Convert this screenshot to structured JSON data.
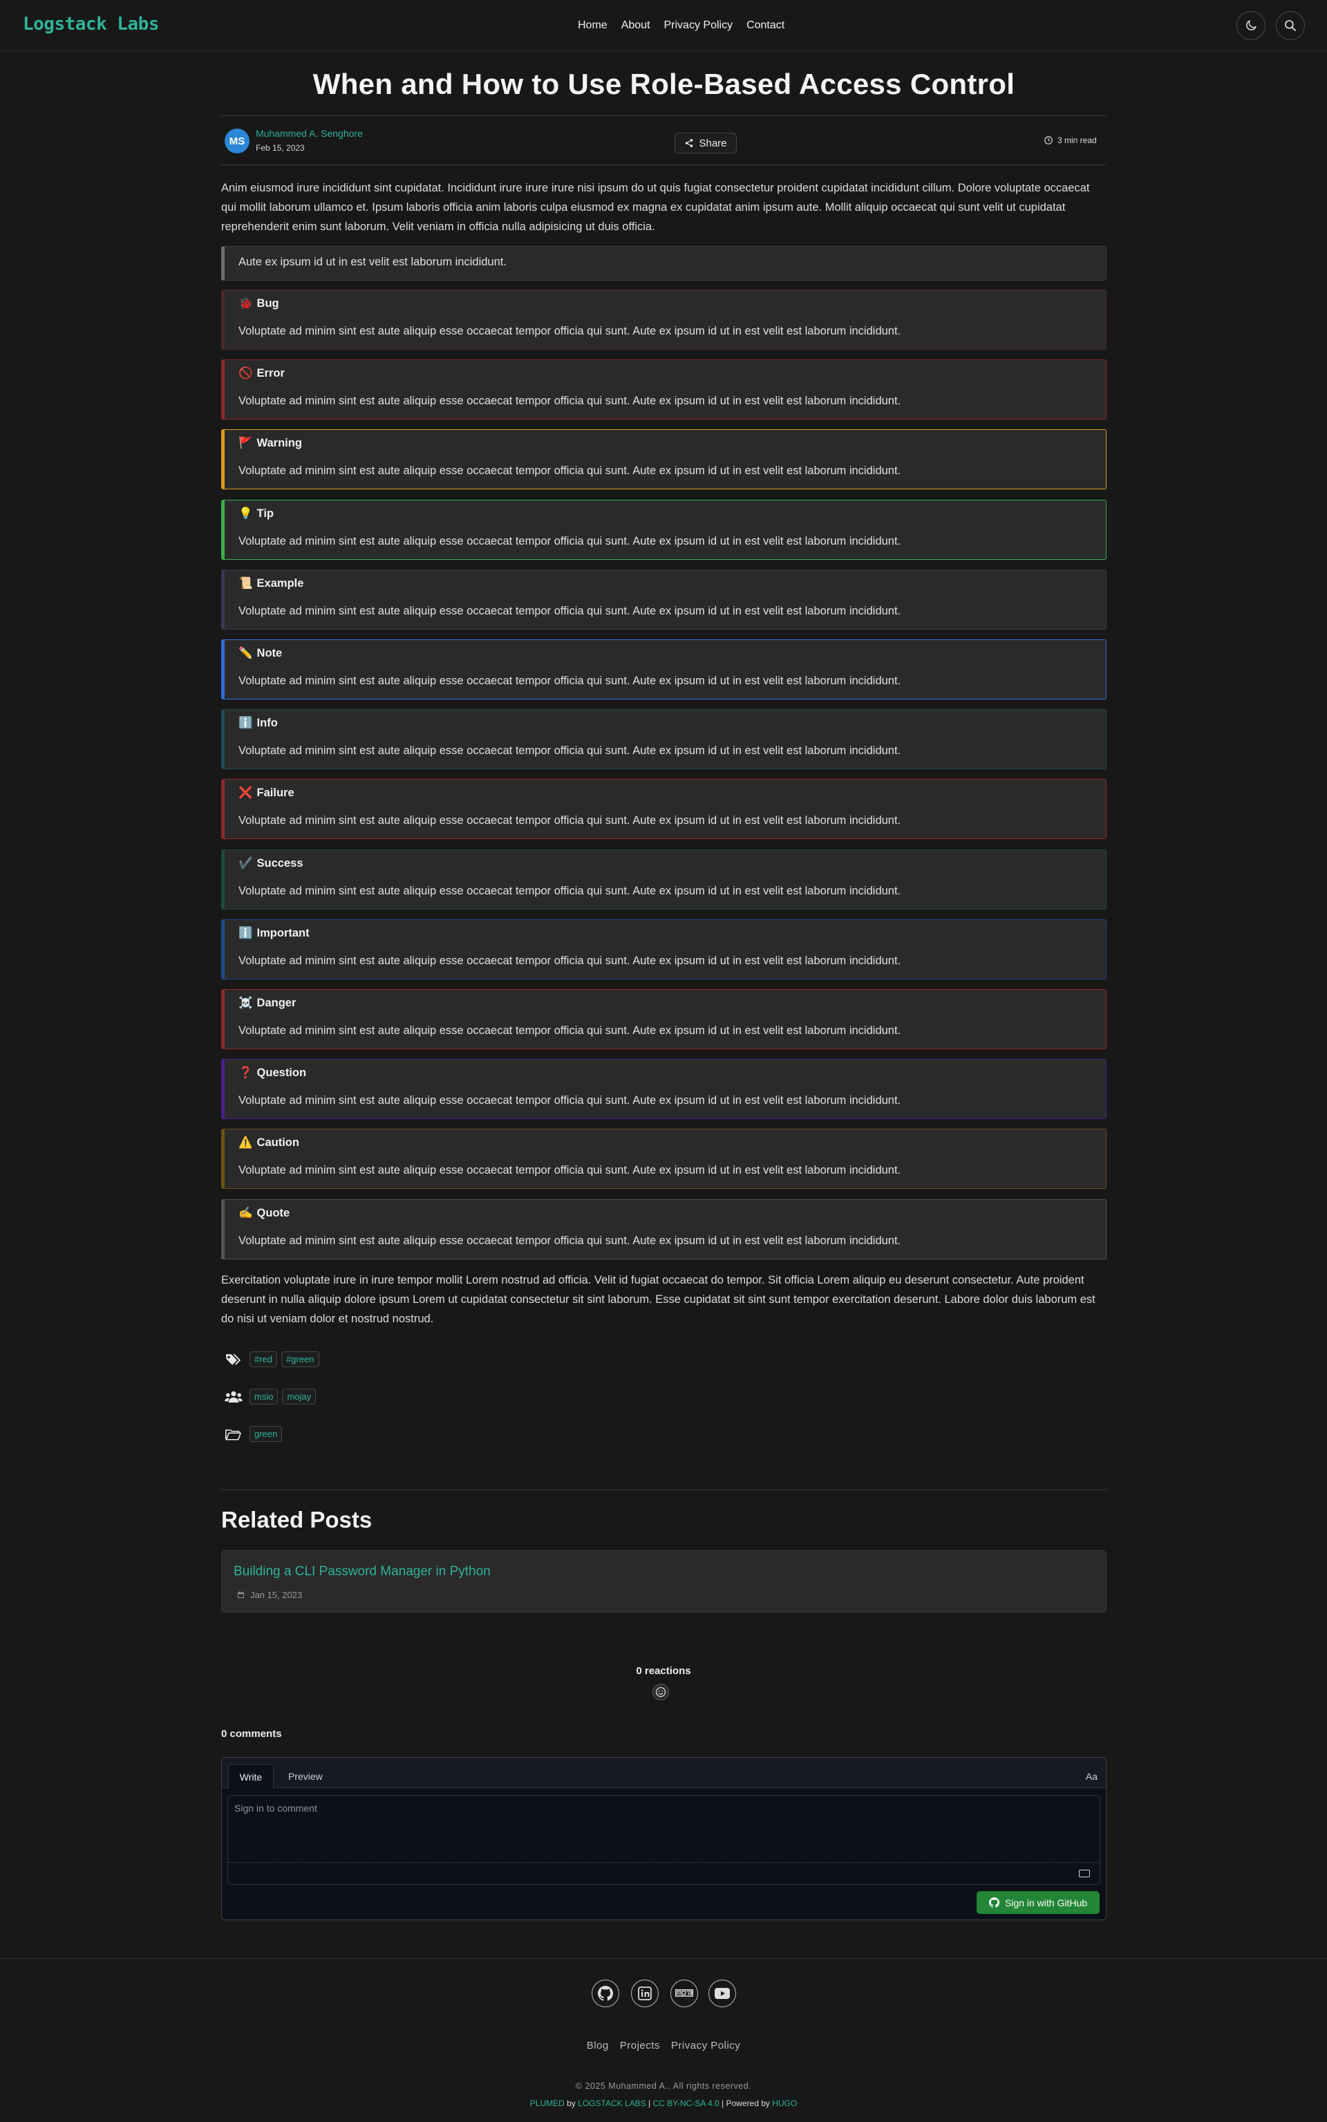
{
  "header": {
    "logo": "Logstack Labs",
    "nav": [
      "Home",
      "About",
      "Privacy Policy",
      "Contact"
    ]
  },
  "article": {
    "title": "When and How to Use Role-Based Access Control",
    "author_initials": "MS",
    "author_name": "Muhammed A. Senghore",
    "date": "Feb 15, 2023",
    "share_label": "Share",
    "read_time": "3 min read",
    "intro": "Anim eiusmod irure incididunt sint cupidatat. Incididunt irure irure irure nisi ipsum do ut quis fugiat consectetur proident cupidatat incididunt cillum. Dolore voluptate occaecat qui mollit laborum ullamco et. Ipsum laboris officia anim laboris culpa eiusmod ex magna ex cupidatat anim ipsum aute. Mollit aliquip occaecat qui sunt velit ut cupidatat reprehenderit enim sunt laborum. Velit veniam in officia nulla adipisicing ut duis officia.",
    "blockquote": "Aute ex ipsum id ut in est velit est laborum incididunt.",
    "admonition_body": "Voluptate ad minim sint est aute aliquip esse occaecat tempor officia qui sunt. Aute ex ipsum id ut in est velit est laborum incididunt.",
    "admonitions": [
      {
        "emoji": "🐞",
        "label": "Bug",
        "color": "#4a2a26"
      },
      {
        "emoji": "🚫",
        "label": "Error",
        "color": "#8b2b2b"
      },
      {
        "emoji": "🚩",
        "label": "Warning",
        "color": "#d99a1c"
      },
      {
        "emoji": "💡",
        "label": "Tip",
        "color": "#3fae4a"
      },
      {
        "emoji": "📜",
        "label": "Example",
        "color": "#3d3552"
      },
      {
        "emoji": "✏️",
        "label": "Note",
        "color": "#2f6fd6"
      },
      {
        "emoji": "ℹ️",
        "label": "Info",
        "color": "#1f4a52"
      },
      {
        "emoji": "❌",
        "label": "Failure",
        "color": "#8b2b2b"
      },
      {
        "emoji": "✔️",
        "label": "Success",
        "color": "#1f4a36"
      },
      {
        "emoji": "ℹ️",
        "label": "Important",
        "color": "#1f4a8a"
      },
      {
        "emoji": "☠️",
        "label": "Danger",
        "color": "#8b2b2b"
      },
      {
        "emoji": "❓",
        "label": "Question",
        "color": "#4a1f8a"
      },
      {
        "emoji": "⚠️",
        "label": "Caution",
        "color": "#6a5216"
      },
      {
        "emoji": "✍️",
        "label": "Quote",
        "color": "#555555"
      }
    ],
    "outro": "Exercitation voluptate irure in irure tempor mollit Lorem nostrud ad officia. Velit id fugiat occaecat do tempor. Sit officia Lorem aliquip eu deserunt consectetur. Aute proident deserunt in nulla aliquip dolore ipsum Lorem ut cupidatat consectetur sit sint laborum. Esse cupidatat sit sint sunt tempor exercitation deserunt. Labore dolor duis laborum est do nisi ut veniam dolor et nostrud nostrud.",
    "tags": [
      "#red",
      "#green"
    ],
    "authors": [
      "msio",
      "mojay"
    ],
    "categories": [
      "green"
    ]
  },
  "related": {
    "heading": "Related Posts",
    "post_title": "Building a CLI Password Manager in Python",
    "post_date": "Jan 15, 2023"
  },
  "comments": {
    "reactions": "0 reactions",
    "count": "0 comments",
    "tab_write": "Write",
    "tab_preview": "Preview",
    "font_toggle": "Aa",
    "placeholder": "Sign in to comment",
    "signin": "Sign in with GitHub"
  },
  "footer": {
    "links": [
      "Blog",
      "Projects",
      "Privacy Policy"
    ],
    "copyright": "© 2025 Muhammed A.. All rights reserved.",
    "powered": {
      "theme": "PLUMED",
      "by": "by",
      "org": "LOGSTACK LABS",
      "license": "CC BY-NC-SA 4.0",
      "powered_by": "Powered by",
      "engine": "HUGO"
    }
  }
}
